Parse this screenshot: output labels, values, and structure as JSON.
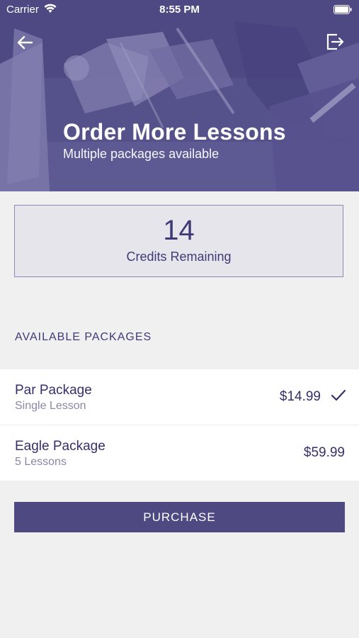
{
  "status_bar": {
    "carrier": "Carrier",
    "time": "8:55 PM"
  },
  "header": {
    "title": "Order More Lessons",
    "subtitle": "Multiple packages available",
    "back_icon": "arrow-left-icon",
    "exit_icon": "logout-icon"
  },
  "credits": {
    "count": "14",
    "label": "Credits Remaining"
  },
  "packages_section": {
    "label": "AVAILABLE PACKAGES",
    "items": [
      {
        "name": "Par Package",
        "detail": "Single Lesson",
        "price": "$14.99",
        "selected": true
      },
      {
        "name": "Eagle Package",
        "detail": "5 Lessons",
        "price": "$59.99",
        "selected": false
      }
    ]
  },
  "purchase_button": {
    "label": "PURCHASE"
  },
  "colors": {
    "primary": "#4e4980",
    "text": "#35306a",
    "muted": "#8a87a8",
    "background": "#f0f0f1"
  }
}
